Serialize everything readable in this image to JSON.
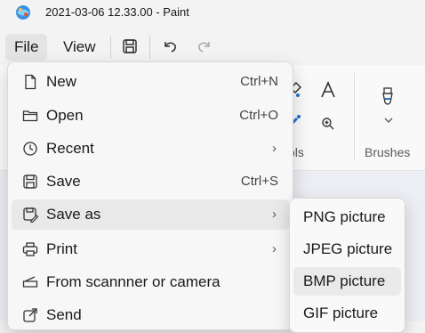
{
  "window": {
    "title": "2021-03-06 12.33.00 - Paint",
    "app_icon": "paint-app-icon"
  },
  "menubar": {
    "file_label": "File",
    "view_label": "View",
    "toolbar_icons": [
      "save-icon",
      "undo-icon",
      "redo-icon"
    ]
  },
  "ribbon": {
    "tools_label": "ols",
    "brushes_label": "Brushes",
    "icons": [
      "fill-icon",
      "text-icon",
      "color-picker-icon",
      "magnifier-icon",
      "brush-icon",
      "chevron-down-icon"
    ]
  },
  "file_menu": {
    "items": [
      {
        "label": "New",
        "shortcut": "Ctrl+N",
        "icon": "new-file-icon"
      },
      {
        "label": "Open",
        "shortcut": "Ctrl+O",
        "icon": "folder-icon"
      },
      {
        "label": "Recent",
        "shortcut": "",
        "icon": "clock-icon",
        "submenu": true
      },
      {
        "label": "Save",
        "shortcut": "Ctrl+S",
        "icon": "save-icon"
      },
      {
        "label": "Save as",
        "shortcut": "",
        "icon": "save-as-icon",
        "submenu": true,
        "active": true
      },
      {
        "label": "Print",
        "shortcut": "",
        "icon": "printer-icon",
        "submenu": true
      },
      {
        "label": "From scannner or camera",
        "shortcut": "",
        "icon": "scanner-icon"
      },
      {
        "label": "Send",
        "shortcut": "",
        "icon": "send-icon"
      }
    ],
    "chevron": "›"
  },
  "save_as_submenu": {
    "items": [
      "PNG picture",
      "JPEG picture",
      "BMP picture",
      "GIF picture"
    ],
    "hovered_index": 2
  }
}
